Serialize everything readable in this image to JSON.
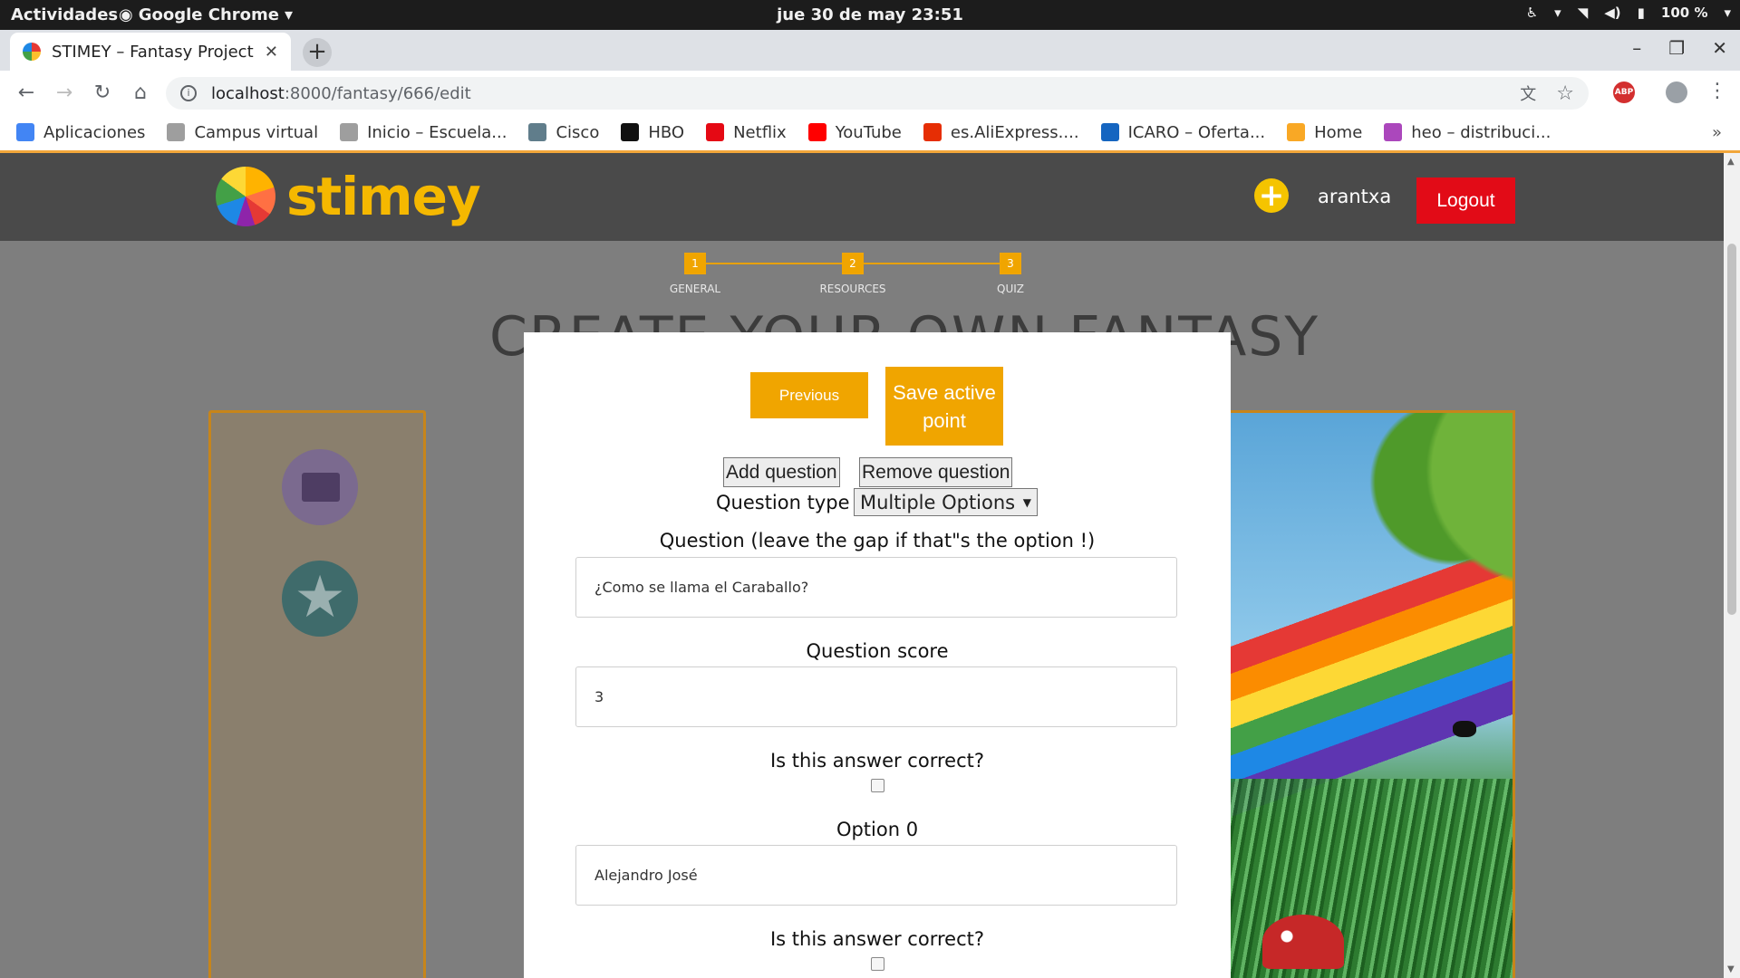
{
  "os": {
    "activities": "Actividades",
    "app_name": "Google Chrome",
    "clock": "jue 30 de may  23:51",
    "battery": "100 %"
  },
  "browser": {
    "tab_title": "STIMEY – Fantasy Project",
    "url_host": "localhost",
    "url_rest": ":8000/fantasy/666/edit",
    "bookmarks": [
      {
        "label": "Aplicaciones",
        "color": "#4285f4"
      },
      {
        "label": "Campus virtual",
        "color": "#9e9e9e"
      },
      {
        "label": "Inicio – Escuela...",
        "color": "#9e9e9e"
      },
      {
        "label": "Cisco",
        "color": "#607d8b"
      },
      {
        "label": "HBO",
        "color": "#111111"
      },
      {
        "label": "Netflix",
        "color": "#e50914"
      },
      {
        "label": "YouTube",
        "color": "#ff0000"
      },
      {
        "label": "es.AliExpress....",
        "color": "#e62e04"
      },
      {
        "label": "ICARO – Oferta...",
        "color": "#1565c0"
      },
      {
        "label": "Home",
        "color": "#f9a825"
      },
      {
        "label": "heo – distribuci...",
        "color": "#ab47bc"
      }
    ],
    "bookmarks_more": "»"
  },
  "site": {
    "brand": "stimey",
    "username": "arantxa",
    "logout_label": "Logout",
    "plus_icon": "+",
    "steps": [
      {
        "num": "1",
        "label": "GENERAL"
      },
      {
        "num": "2",
        "label": "RESOURCES"
      },
      {
        "num": "3",
        "label": "QUIZ"
      }
    ],
    "page_title": "CREATE YOUR OWN FANTASY",
    "accent_color": "#f0a500",
    "logout_color": "#e20b17"
  },
  "modal": {
    "previous_label": "Previous",
    "save_label": "Save active point",
    "add_question_label": "Add question",
    "remove_question_label": "Remove question",
    "question_type_label": "Question type",
    "question_type_value": "Multiple Options",
    "question_label": "Question (leave the gap if that\"s the option !)",
    "question_value": "¿Como se llama el Caraballo?",
    "score_label": "Question score",
    "score_value": "3",
    "correct_label_1": "Is this answer correct?",
    "option0_label": "Option 0",
    "option0_value": "Alejandro José",
    "correct_label_2": "Is this answer correct?"
  }
}
